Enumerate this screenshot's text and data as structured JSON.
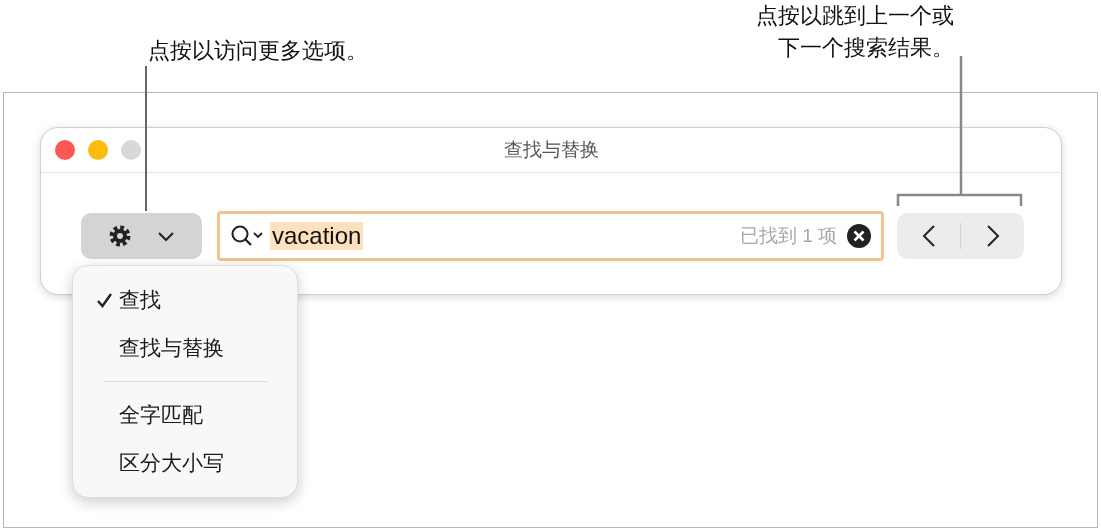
{
  "callouts": [
    {
      "lines": [
        "点按以访问更多选项。"
      ]
    },
    {
      "lines": [
        "点按以跳到上一个或",
        "下一个搜索结果。"
      ]
    }
  ],
  "window": {
    "title": "查找与替换"
  },
  "search": {
    "value": "vacation",
    "result_count": "已找到 1 项"
  },
  "menu": {
    "sections": [
      [
        {
          "label": "查找",
          "checked": true
        },
        {
          "label": "查找与替换",
          "checked": false
        }
      ],
      [
        {
          "label": "全字匹配",
          "checked": false
        },
        {
          "label": "区分大小写",
          "checked": false
        }
      ]
    ]
  }
}
